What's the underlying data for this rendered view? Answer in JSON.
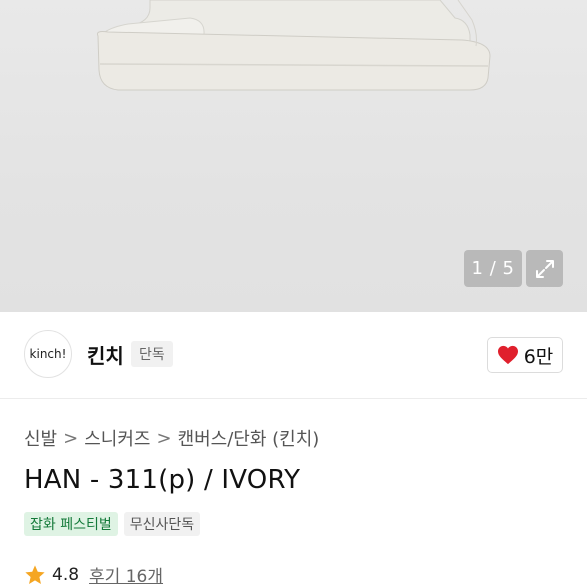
{
  "gallery": {
    "counter": "1 / 5",
    "expand_icon": "expand-icon"
  },
  "brand": {
    "logo_text": "kinch!",
    "name": "킨치",
    "tag": "단독"
  },
  "like": {
    "icon": "heart-icon",
    "color": "#e0202d",
    "count": "6만"
  },
  "breadcrumb": {
    "items": [
      "신발",
      "스니커즈",
      "캔버스/단화 (킨치)"
    ],
    "separator": ">"
  },
  "product": {
    "title": "HAN - 311(p) / IVORY"
  },
  "badges": {
    "festival": "잡화 페스티벌",
    "exclusive": "무신사단독"
  },
  "rating": {
    "icon": "star-icon",
    "color": "#f5a623",
    "score": "4.8",
    "reviews": "후기 16개"
  }
}
